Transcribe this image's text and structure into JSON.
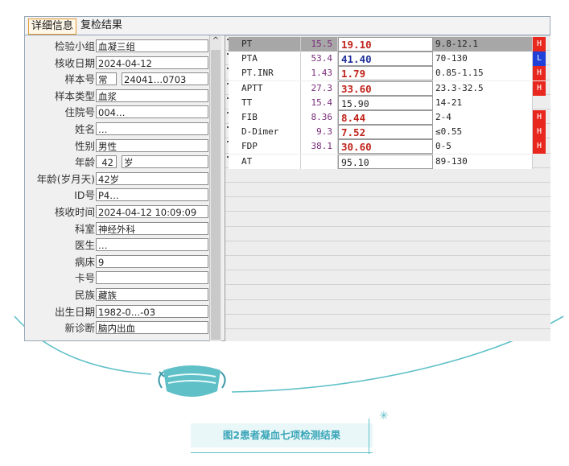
{
  "tabs": [
    "详细信息",
    "复检结果"
  ],
  "patient": {
    "fields": [
      {
        "label": "检验小组",
        "value": "血凝三组"
      },
      {
        "label": "核收日期",
        "value": "2024-04-12"
      },
      {
        "label": "样本号",
        "value": "常",
        "value2": "24041…0703"
      },
      {
        "label": "样本类型",
        "value": "血浆"
      },
      {
        "label": "住院号",
        "value": "004…"
      },
      {
        "label": "姓名",
        "value": "…"
      },
      {
        "label": "性别",
        "value": "男性"
      },
      {
        "label": "年龄",
        "value": "42",
        "value2": "岁"
      },
      {
        "label": "年龄(岁月天)",
        "value": "42岁"
      },
      {
        "label": "ID号",
        "value": "P4…"
      },
      {
        "label": "核收时间",
        "value": "2024-04-12 10:09:09"
      },
      {
        "label": "科室",
        "value": "神经外科"
      },
      {
        "label": "医生",
        "value": "…"
      },
      {
        "label": "病床",
        "value": "9"
      },
      {
        "label": "卡号",
        "value": ""
      },
      {
        "label": "民族",
        "value": "藏族"
      },
      {
        "label": "出生日期",
        "value": "1982-0…-03"
      },
      {
        "label": "新诊断",
        "value": "脑内出血"
      }
    ]
  },
  "results": {
    "rows": [
      {
        "name": "PT",
        "prev": "15.5",
        "current": "19.10",
        "ref": "9.8-12.1",
        "flag": "H"
      },
      {
        "name": "PTA",
        "prev": "53.4",
        "current": "41.40",
        "ref": "70-130",
        "flag": "L"
      },
      {
        "name": "PT.INR",
        "prev": "1.43",
        "current": "1.79",
        "ref": "0.85-1.15",
        "flag": "H"
      },
      {
        "name": "APTT",
        "prev": "27.3",
        "current": "33.60",
        "ref": "23.3-32.5",
        "flag": "H"
      },
      {
        "name": "TT",
        "prev": "15.4",
        "current": "15.90",
        "ref": "14-21",
        "flag": ""
      },
      {
        "name": "FIB",
        "prev": "8.36",
        "current": "8.44",
        "ref": "2-4",
        "flag": "H"
      },
      {
        "name": "D-Dimer",
        "prev": "9.3",
        "current": "7.52",
        "ref": "≤0.55",
        "flag": "H"
      },
      {
        "name": "FDP",
        "prev": "38.1",
        "current": "30.60",
        "ref": "0-5",
        "flag": "H"
      },
      {
        "name": "AT",
        "prev": "",
        "current": "95.10",
        "ref": "89-130",
        "flag": ""
      }
    ]
  },
  "colors": {
    "high_text": "#c0241b",
    "low_text": "#1f2f9a",
    "high_flag": "#e8281e",
    "low_flag": "#1e3fd8",
    "accent": "#5fc0c8"
  },
  "caption": "图2患者凝血七项检测结果"
}
